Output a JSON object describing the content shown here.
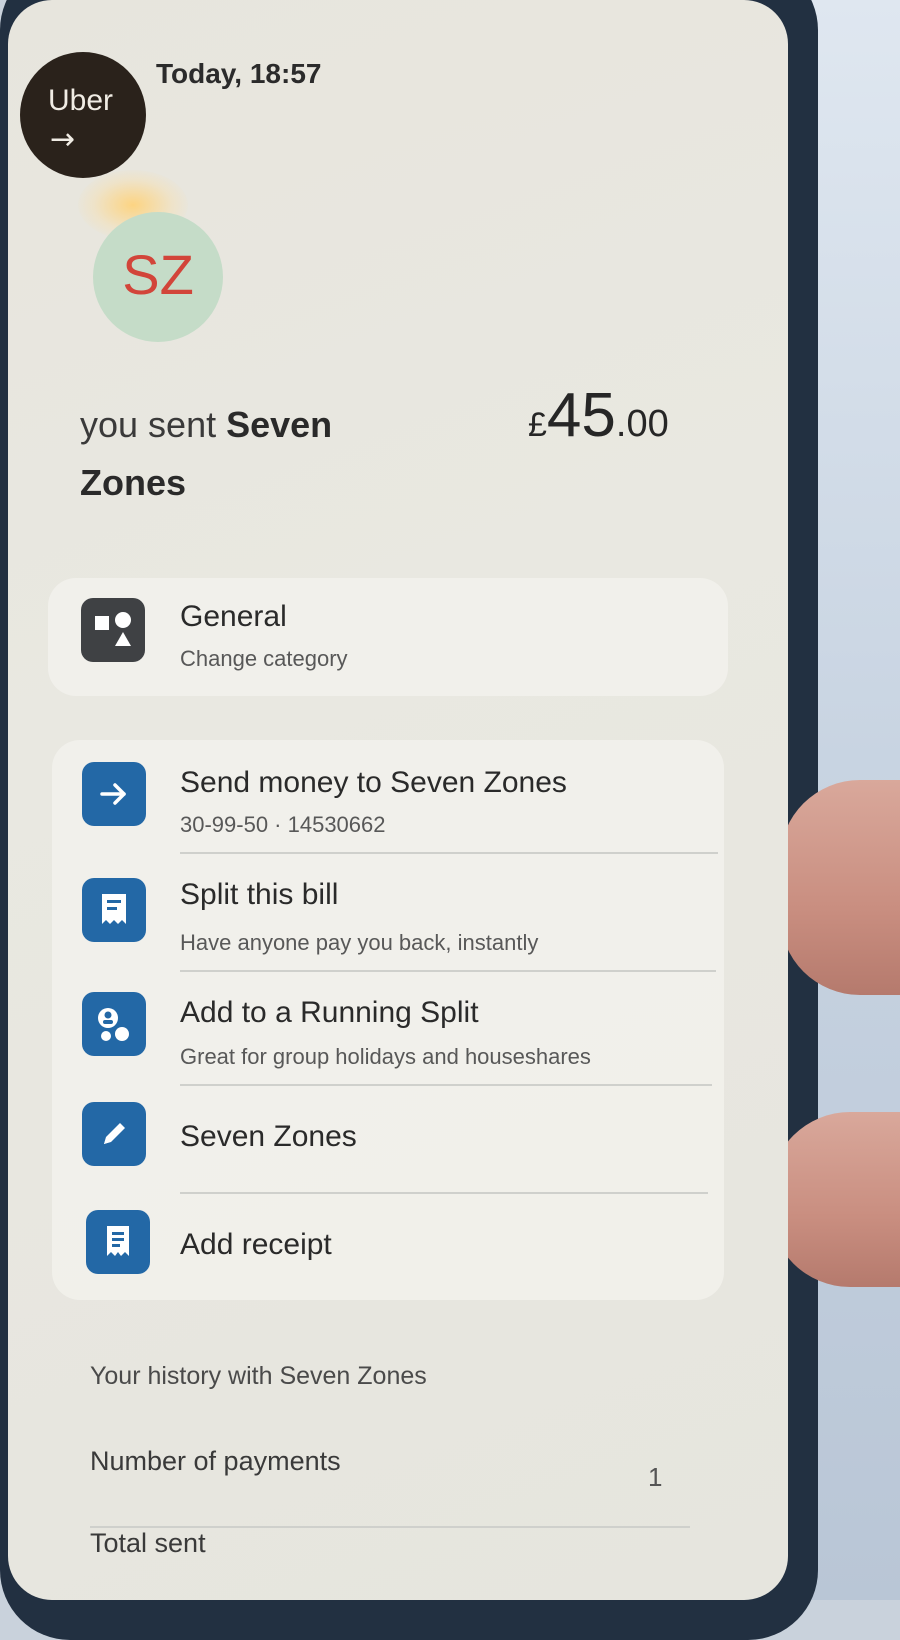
{
  "merchant": {
    "logo_text": "Uber",
    "logo_arrow": "→",
    "timestamp": "Today, 18:57"
  },
  "avatar": {
    "initials": "SZ"
  },
  "transaction": {
    "sent_prefix": "you sent",
    "payee": "Seven Zones",
    "amount_currency": "£",
    "amount_whole": "45",
    "amount_decimal": ".00"
  },
  "category": {
    "title": "General",
    "subtitle": "Change category",
    "icon": "shapes-icon"
  },
  "actions": [
    {
      "title": "Send money to Seven Zones",
      "subtitle": "30-99-50 · 14530662",
      "icon": "arrow-right-icon"
    },
    {
      "title": "Split this bill",
      "subtitle": "Have anyone pay you back, instantly",
      "icon": "receipt-split-icon"
    },
    {
      "title": "Add to a Running Split",
      "subtitle": "Great for group holidays and houseshares",
      "icon": "group-icon"
    },
    {
      "title": "Seven Zones",
      "subtitle": "",
      "icon": "pencil-icon"
    },
    {
      "title": "Add receipt",
      "subtitle": "",
      "icon": "receipt-icon"
    }
  ],
  "history": {
    "title": "Your history with Seven Zones",
    "rows": [
      {
        "label": "Number of payments",
        "value": "1"
      },
      {
        "label": "Total sent",
        "value": ""
      }
    ]
  },
  "colors": {
    "accent_blue": "#2368a6",
    "avatar_bg": "#c5dcc8",
    "avatar_text": "#d2453a"
  }
}
